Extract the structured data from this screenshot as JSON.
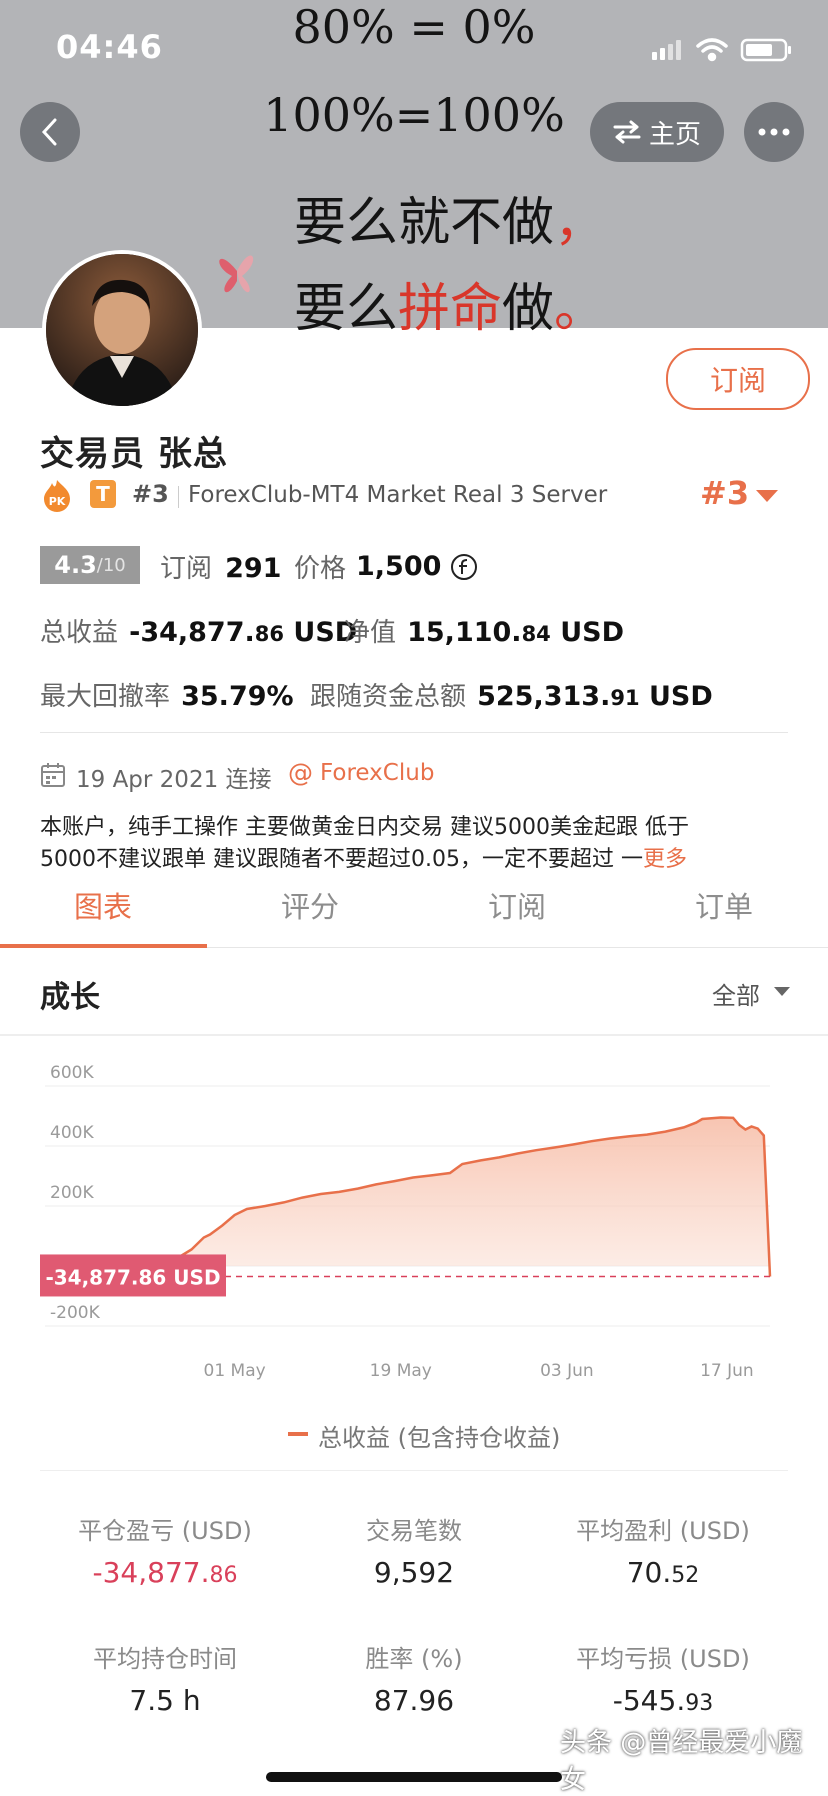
{
  "status_bar": {
    "time": "04:46"
  },
  "banner": {
    "line1": "80% = 0%",
    "line2": "100%=100%",
    "line3_a": "要么就不做",
    "line3_b": "，",
    "line4_a": "要么",
    "line4_b": "拼命",
    "line4_c": "做",
    "line4_d": "。"
  },
  "nav": {
    "home_label": "主页"
  },
  "profile": {
    "subscribe_label": "订阅",
    "trader_name": "交易员  张总",
    "t_badge": "T",
    "rank_small": "#3",
    "server": "ForexClub-MT4 Market Real 3 Server",
    "rank_big": "#3",
    "score": "4.3",
    "score_max": "/10",
    "subs_label": "订阅",
    "subs_value": "291",
    "price_label": "价格",
    "price_value": "1,500",
    "total_profit_label": "总收益",
    "total_profit_int": "-34,877.",
    "total_profit_dec": "86",
    "total_profit_unit": " USD",
    "equity_label": "净值",
    "equity_int": "15,110.",
    "equity_dec": "84",
    "equity_unit": " USD",
    "drawdown_label": "最大回撤率",
    "drawdown_value": "35.79%",
    "follow_label": "跟随资金总额",
    "follow_int": "525,313.",
    "follow_dec": "91",
    "follow_unit": " USD",
    "connect_date": "19 Apr 2021 连接",
    "broker_at": "@",
    "broker": "ForexClub",
    "desc_line1": "本账户，纯手工操作 主要做黄金日内交易   建议5000美金起跟  低于",
    "desc_line2": "5000不建议跟单 建议跟随者不要超过0.05，一定不要超过  一",
    "desc_more": "更多"
  },
  "tabs": [
    "图表",
    "评分",
    "订阅",
    "订单"
  ],
  "growth": {
    "title": "成长",
    "range": "全部"
  },
  "legend": "总收益 (包含持仓收益)",
  "chart_data": {
    "type": "area",
    "series": [
      {
        "name": "总收益 (包含持仓收益)",
        "color": "#e8704a"
      }
    ],
    "y_ticks": [
      "600K",
      "400K",
      "200K",
      "-200K"
    ],
    "x_ticks": [
      "01 May",
      "19 May",
      "03 Jun",
      "17 Jun"
    ],
    "ylim": [
      -200000,
      600000
    ],
    "current_label": "-34,877.86 USD",
    "current_value": -34877.86,
    "points": [
      [
        0,
        0
      ],
      [
        3,
        1000
      ],
      [
        6,
        8000
      ],
      [
        8,
        30000
      ],
      [
        10,
        55000
      ],
      [
        12,
        95000
      ],
      [
        13,
        105000
      ],
      [
        15,
        135000
      ],
      [
        17,
        170000
      ],
      [
        19,
        190000
      ],
      [
        22,
        200000
      ],
      [
        25,
        212000
      ],
      [
        28,
        228000
      ],
      [
        31,
        240000
      ],
      [
        34,
        247000
      ],
      [
        37,
        258000
      ],
      [
        40,
        272000
      ],
      [
        43,
        283000
      ],
      [
        46,
        295000
      ],
      [
        49,
        302000
      ],
      [
        52,
        310000
      ],
      [
        54,
        340000
      ],
      [
        57,
        352000
      ],
      [
        60,
        362000
      ],
      [
        63,
        375000
      ],
      [
        66,
        386000
      ],
      [
        69,
        395000
      ],
      [
        72,
        405000
      ],
      [
        75,
        416000
      ],
      [
        78,
        425000
      ],
      [
        81,
        432000
      ],
      [
        84,
        438000
      ],
      [
        87,
        448000
      ],
      [
        90,
        462000
      ],
      [
        92,
        478000
      ],
      [
        93,
        490000
      ],
      [
        96,
        495000
      ],
      [
        98,
        494000
      ],
      [
        99,
        470000
      ],
      [
        100,
        455000
      ],
      [
        101,
        465000
      ],
      [
        102,
        458000
      ],
      [
        103,
        435000
      ],
      [
        104,
        -34877.86
      ]
    ],
    "x_domain": [
      0,
      104
    ],
    "x_tick_positions": [
      17,
      44,
      71,
      97
    ]
  },
  "stats": [
    {
      "label": "平仓盈亏 (USD)",
      "int": "-34,877.",
      "dec": "86",
      "negative": true
    },
    {
      "label": "交易笔数",
      "int": "9,592",
      "dec": "",
      "negative": false
    },
    {
      "label": "平均盈利 (USD)",
      "int": "70.",
      "dec": "52",
      "negative": false
    },
    {
      "label": "平均持仓时间",
      "int": "7.5 h",
      "dec": "",
      "negative": false
    },
    {
      "label": "胜率 (%)",
      "int": "87.96",
      "dec": "",
      "negative": false
    },
    {
      "label": "平均亏损 (USD)",
      "int": "-545.",
      "dec": "93",
      "negative": false
    }
  ],
  "watermark": "头条 @曾经最爱小魔女",
  "colors": {
    "accent": "#e8704a",
    "negative": "#d9405a",
    "banner_bg": "#b3b4b7"
  }
}
